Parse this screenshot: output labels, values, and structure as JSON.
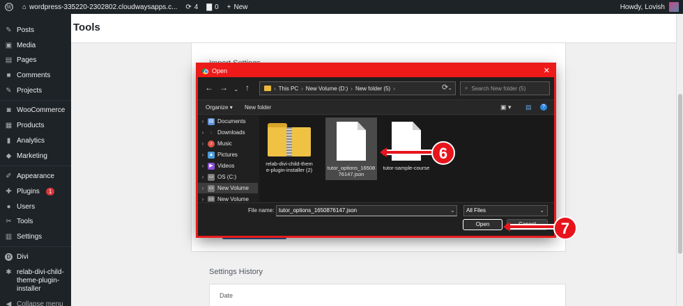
{
  "adminbar": {
    "site": "wordpress-335220-2302802.cloudwaysapps.c...",
    "updates": "4",
    "comments": "0",
    "new_label": "New",
    "howdy": "Howdy, Lovish"
  },
  "sidebar": {
    "items": [
      {
        "label": "Posts",
        "icon": "pin-icon"
      },
      {
        "label": "Media",
        "icon": "media-icon"
      },
      {
        "label": "Pages",
        "icon": "pages-icon"
      },
      {
        "label": "Comments",
        "icon": "comment-icon"
      },
      {
        "label": "Projects",
        "icon": "pin-icon"
      },
      {
        "label": "WooCommerce",
        "icon": "woo-icon"
      },
      {
        "label": "Products",
        "icon": "products-icon"
      },
      {
        "label": "Analytics",
        "icon": "analytics-icon"
      },
      {
        "label": "Marketing",
        "icon": "megaphone-icon"
      },
      {
        "label": "Appearance",
        "icon": "brush-icon"
      },
      {
        "label": "Plugins",
        "icon": "plug-icon",
        "badge": "1"
      },
      {
        "label": "Users",
        "icon": "user-icon"
      },
      {
        "label": "Tools",
        "icon": "wrench-icon"
      },
      {
        "label": "Settings",
        "icon": "settings-icon"
      },
      {
        "label": "Divi",
        "icon": "divi-icon"
      },
      {
        "label": "relab-divi-child-theme-plugin-installer",
        "icon": "gear-icon"
      },
      {
        "label": "Collapse menu",
        "icon": "collapse-icon"
      }
    ]
  },
  "page": {
    "title": "Tools",
    "import_title": "Import Settings",
    "history_title": "Settings History",
    "history_col": "Date"
  },
  "dialog": {
    "title": "Open",
    "breadcrumb": [
      "This PC",
      "New Volume (D:)",
      "New folder (5)"
    ],
    "search_placeholder": "Search New folder (5)",
    "organize": "Organize",
    "new_folder": "New folder",
    "tree": [
      {
        "label": "Documents",
        "color": "#5d8fd6"
      },
      {
        "label": "Downloads",
        "color": "#3b9be0"
      },
      {
        "label": "Music",
        "color": "#e0564c"
      },
      {
        "label": "Pictures",
        "color": "#4a9de0"
      },
      {
        "label": "Videos",
        "color": "#8c4fd6"
      },
      {
        "label": "OS (C:)",
        "color": "#7a7a7a"
      },
      {
        "label": "New Volume",
        "color": "#7a7a7a"
      },
      {
        "label": "New Volume",
        "color": "#7a7a7a"
      }
    ],
    "files": [
      {
        "name": "relab-divi-child-theme-plugin-installer (2)",
        "kind": "zip"
      },
      {
        "name": "tutor_options_1650876147.json",
        "kind": "doc"
      },
      {
        "name": "tutor-sample-course",
        "kind": "doc"
      }
    ],
    "file_name_label": "File name:",
    "file_name_value": "tutor_options_1650876147.json",
    "filter": "All Files",
    "open_label": "Open",
    "cancel_label": "Cancel"
  },
  "annotations": {
    "step_a": "6",
    "step_b": "7"
  },
  "colors": {
    "accent_red": "#e8141c",
    "wp_dark": "#1d2327"
  }
}
